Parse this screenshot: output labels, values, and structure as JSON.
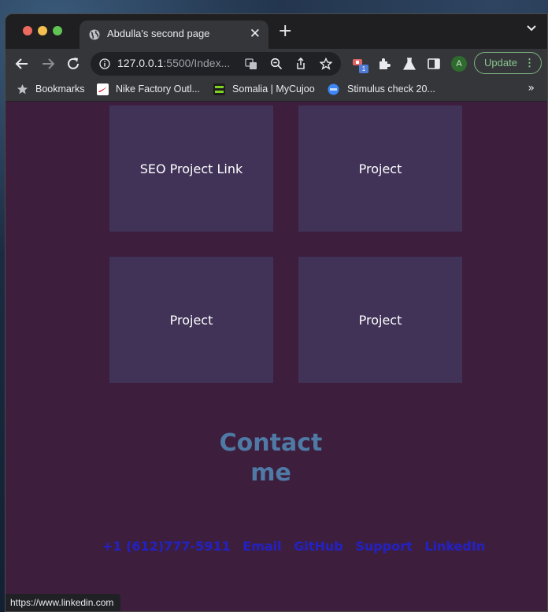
{
  "browser": {
    "tab_title": "Abdulla's second page",
    "url_host": "127.0.0.1",
    "url_rest": ":5500/Index...",
    "extension_badge": "1",
    "avatar_letter": "A",
    "update_label": "Update"
  },
  "bookmarks": {
    "label": "Bookmarks",
    "items": [
      "Nike Factory Outl...",
      "Somalia | MyCujoo",
      "Stimulus check 20..."
    ]
  },
  "projects": [
    "SEO Project Link",
    "Project",
    "Project",
    "Project"
  ],
  "contact": {
    "line1": "Contact",
    "line2": "me"
  },
  "links": [
    "+1 (612)777-5911",
    "Email",
    "GitHub",
    "Support",
    "LinkedIn"
  ],
  "status_url": "https://www.linkedin.com",
  "colors": {
    "page_bg": "#3d1f3d",
    "card_bg": "#413358",
    "heading": "#4f7aa5",
    "link": "#2321c4"
  }
}
